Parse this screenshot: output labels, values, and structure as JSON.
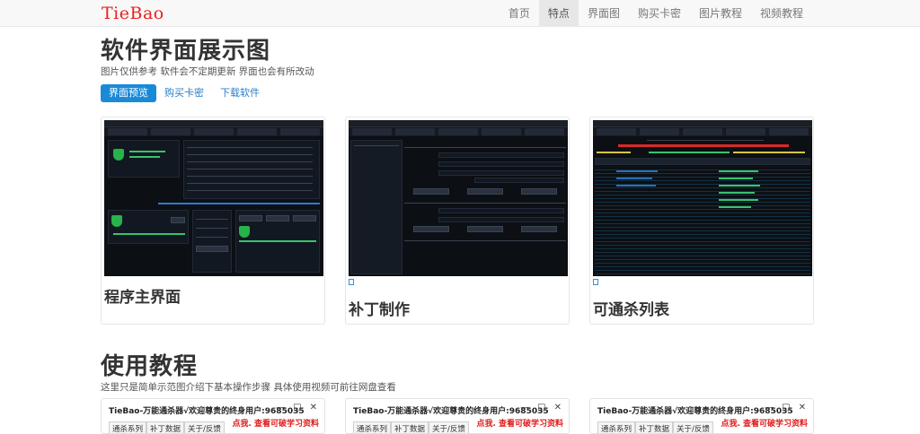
{
  "brand": "TieBao",
  "nav": [
    "首页",
    "特点",
    "界面图",
    "购买卡密",
    "图片教程",
    "视频教程"
  ],
  "nav_active": "特点",
  "section1": {
    "title": "软件界面展示图",
    "subtitle": "图片仅供参考 软件会不定期更新 界面也会有所改动",
    "buttons": [
      "界面预览",
      "购买卡密",
      "下载软件"
    ]
  },
  "cards": [
    {
      "caption": "程序主界面"
    },
    {
      "caption": "补丁制作"
    },
    {
      "caption": "可通杀列表"
    }
  ],
  "section2": {
    "title": "使用教程",
    "subtitle": "这里只是简单示范图介绍下基本操作步骤 具体使用视频可前往网盘查看"
  },
  "tutorial_window": {
    "title": "TieBao-万能通杀器√欢迎尊贵的终身用户:9685035",
    "link": "点我. 查看可破学习资料",
    "tabs": [
      "通杀系列",
      "补丁数据",
      "关于/反馈"
    ],
    "controls": [
      "—",
      "□",
      "✕"
    ]
  },
  "colors": {
    "brand": "#e8231f",
    "primary": "#1a8ad8",
    "link": "#2a7fc8",
    "red_link": "#e01b1b"
  }
}
